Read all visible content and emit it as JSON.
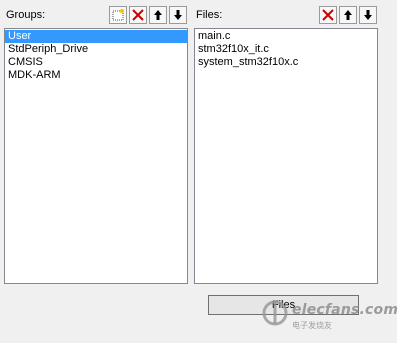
{
  "groups": {
    "title": "Groups:",
    "items": [
      "User",
      "StdPeriph_Drive",
      "CMSIS",
      "MDK-ARM"
    ],
    "selected": "User"
  },
  "files": {
    "title": "Files:",
    "items": [
      "main.c",
      "stm32f10x_it.c",
      "system_stm32f10x.c"
    ]
  },
  "bottom_button": {
    "label": "Files"
  },
  "watermark": {
    "text": "elecfans.com",
    "sub": "电子发烧友"
  },
  "icons": {
    "new": "new-group-icon",
    "delete": "delete-icon",
    "up": "arrow-up-icon",
    "down": "arrow-down-icon"
  },
  "colors": {
    "selection": "#3399ff",
    "delete": "#cc0000"
  }
}
